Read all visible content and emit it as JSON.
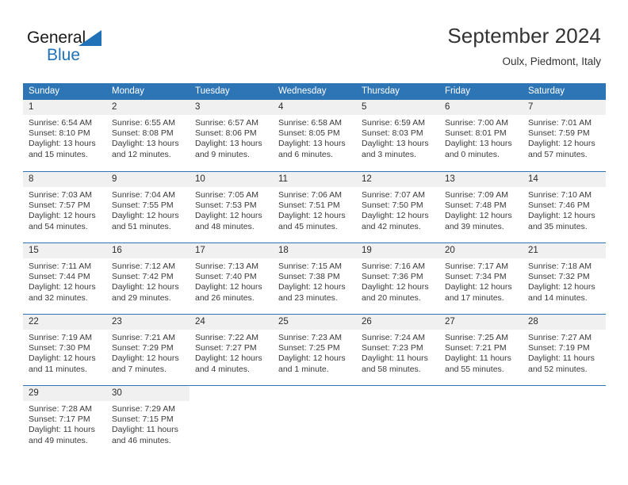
{
  "brand": {
    "name_dark": "General",
    "name_blue": "Blue",
    "accent_color": "#1f71b8",
    "triangle_icon": "blue-triangle-icon"
  },
  "header": {
    "title": "September 2024",
    "subtitle": "Oulx, Piedmont, Italy"
  },
  "colors": {
    "header_band": "#2e75b6",
    "daynum_band": "#f0f0f0",
    "row_divider": "#2e75b6",
    "text": "#3a3a3a"
  },
  "calendar": {
    "weekdays": [
      "Sunday",
      "Monday",
      "Tuesday",
      "Wednesday",
      "Thursday",
      "Friday",
      "Saturday"
    ],
    "weeks": [
      [
        {
          "day": "1",
          "sunrise": "Sunrise: 6:54 AM",
          "sunset": "Sunset: 8:10 PM",
          "daylight1": "Daylight: 13 hours",
          "daylight2": "and 15 minutes."
        },
        {
          "day": "2",
          "sunrise": "Sunrise: 6:55 AM",
          "sunset": "Sunset: 8:08 PM",
          "daylight1": "Daylight: 13 hours",
          "daylight2": "and 12 minutes."
        },
        {
          "day": "3",
          "sunrise": "Sunrise: 6:57 AM",
          "sunset": "Sunset: 8:06 PM",
          "daylight1": "Daylight: 13 hours",
          "daylight2": "and 9 minutes."
        },
        {
          "day": "4",
          "sunrise": "Sunrise: 6:58 AM",
          "sunset": "Sunset: 8:05 PM",
          "daylight1": "Daylight: 13 hours",
          "daylight2": "and 6 minutes."
        },
        {
          "day": "5",
          "sunrise": "Sunrise: 6:59 AM",
          "sunset": "Sunset: 8:03 PM",
          "daylight1": "Daylight: 13 hours",
          "daylight2": "and 3 minutes."
        },
        {
          "day": "6",
          "sunrise": "Sunrise: 7:00 AM",
          "sunset": "Sunset: 8:01 PM",
          "daylight1": "Daylight: 13 hours",
          "daylight2": "and 0 minutes."
        },
        {
          "day": "7",
          "sunrise": "Sunrise: 7:01 AM",
          "sunset": "Sunset: 7:59 PM",
          "daylight1": "Daylight: 12 hours",
          "daylight2": "and 57 minutes."
        }
      ],
      [
        {
          "day": "8",
          "sunrise": "Sunrise: 7:03 AM",
          "sunset": "Sunset: 7:57 PM",
          "daylight1": "Daylight: 12 hours",
          "daylight2": "and 54 minutes."
        },
        {
          "day": "9",
          "sunrise": "Sunrise: 7:04 AM",
          "sunset": "Sunset: 7:55 PM",
          "daylight1": "Daylight: 12 hours",
          "daylight2": "and 51 minutes."
        },
        {
          "day": "10",
          "sunrise": "Sunrise: 7:05 AM",
          "sunset": "Sunset: 7:53 PM",
          "daylight1": "Daylight: 12 hours",
          "daylight2": "and 48 minutes."
        },
        {
          "day": "11",
          "sunrise": "Sunrise: 7:06 AM",
          "sunset": "Sunset: 7:51 PM",
          "daylight1": "Daylight: 12 hours",
          "daylight2": "and 45 minutes."
        },
        {
          "day": "12",
          "sunrise": "Sunrise: 7:07 AM",
          "sunset": "Sunset: 7:50 PM",
          "daylight1": "Daylight: 12 hours",
          "daylight2": "and 42 minutes."
        },
        {
          "day": "13",
          "sunrise": "Sunrise: 7:09 AM",
          "sunset": "Sunset: 7:48 PM",
          "daylight1": "Daylight: 12 hours",
          "daylight2": "and 39 minutes."
        },
        {
          "day": "14",
          "sunrise": "Sunrise: 7:10 AM",
          "sunset": "Sunset: 7:46 PM",
          "daylight1": "Daylight: 12 hours",
          "daylight2": "and 35 minutes."
        }
      ],
      [
        {
          "day": "15",
          "sunrise": "Sunrise: 7:11 AM",
          "sunset": "Sunset: 7:44 PM",
          "daylight1": "Daylight: 12 hours",
          "daylight2": "and 32 minutes."
        },
        {
          "day": "16",
          "sunrise": "Sunrise: 7:12 AM",
          "sunset": "Sunset: 7:42 PM",
          "daylight1": "Daylight: 12 hours",
          "daylight2": "and 29 minutes."
        },
        {
          "day": "17",
          "sunrise": "Sunrise: 7:13 AM",
          "sunset": "Sunset: 7:40 PM",
          "daylight1": "Daylight: 12 hours",
          "daylight2": "and 26 minutes."
        },
        {
          "day": "18",
          "sunrise": "Sunrise: 7:15 AM",
          "sunset": "Sunset: 7:38 PM",
          "daylight1": "Daylight: 12 hours",
          "daylight2": "and 23 minutes."
        },
        {
          "day": "19",
          "sunrise": "Sunrise: 7:16 AM",
          "sunset": "Sunset: 7:36 PM",
          "daylight1": "Daylight: 12 hours",
          "daylight2": "and 20 minutes."
        },
        {
          "day": "20",
          "sunrise": "Sunrise: 7:17 AM",
          "sunset": "Sunset: 7:34 PM",
          "daylight1": "Daylight: 12 hours",
          "daylight2": "and 17 minutes."
        },
        {
          "day": "21",
          "sunrise": "Sunrise: 7:18 AM",
          "sunset": "Sunset: 7:32 PM",
          "daylight1": "Daylight: 12 hours",
          "daylight2": "and 14 minutes."
        }
      ],
      [
        {
          "day": "22",
          "sunrise": "Sunrise: 7:19 AM",
          "sunset": "Sunset: 7:30 PM",
          "daylight1": "Daylight: 12 hours",
          "daylight2": "and 11 minutes."
        },
        {
          "day": "23",
          "sunrise": "Sunrise: 7:21 AM",
          "sunset": "Sunset: 7:29 PM",
          "daylight1": "Daylight: 12 hours",
          "daylight2": "and 7 minutes."
        },
        {
          "day": "24",
          "sunrise": "Sunrise: 7:22 AM",
          "sunset": "Sunset: 7:27 PM",
          "daylight1": "Daylight: 12 hours",
          "daylight2": "and 4 minutes."
        },
        {
          "day": "25",
          "sunrise": "Sunrise: 7:23 AM",
          "sunset": "Sunset: 7:25 PM",
          "daylight1": "Daylight: 12 hours",
          "daylight2": "and 1 minute."
        },
        {
          "day": "26",
          "sunrise": "Sunrise: 7:24 AM",
          "sunset": "Sunset: 7:23 PM",
          "daylight1": "Daylight: 11 hours",
          "daylight2": "and 58 minutes."
        },
        {
          "day": "27",
          "sunrise": "Sunrise: 7:25 AM",
          "sunset": "Sunset: 7:21 PM",
          "daylight1": "Daylight: 11 hours",
          "daylight2": "and 55 minutes."
        },
        {
          "day": "28",
          "sunrise": "Sunrise: 7:27 AM",
          "sunset": "Sunset: 7:19 PM",
          "daylight1": "Daylight: 11 hours",
          "daylight2": "and 52 minutes."
        }
      ],
      [
        {
          "day": "29",
          "sunrise": "Sunrise: 7:28 AM",
          "sunset": "Sunset: 7:17 PM",
          "daylight1": "Daylight: 11 hours",
          "daylight2": "and 49 minutes."
        },
        {
          "day": "30",
          "sunrise": "Sunrise: 7:29 AM",
          "sunset": "Sunset: 7:15 PM",
          "daylight1": "Daylight: 11 hours",
          "daylight2": "and 46 minutes."
        },
        {
          "day": "",
          "sunrise": "",
          "sunset": "",
          "daylight1": "",
          "daylight2": ""
        },
        {
          "day": "",
          "sunrise": "",
          "sunset": "",
          "daylight1": "",
          "daylight2": ""
        },
        {
          "day": "",
          "sunrise": "",
          "sunset": "",
          "daylight1": "",
          "daylight2": ""
        },
        {
          "day": "",
          "sunrise": "",
          "sunset": "",
          "daylight1": "",
          "daylight2": ""
        },
        {
          "day": "",
          "sunrise": "",
          "sunset": "",
          "daylight1": "",
          "daylight2": ""
        }
      ]
    ]
  }
}
